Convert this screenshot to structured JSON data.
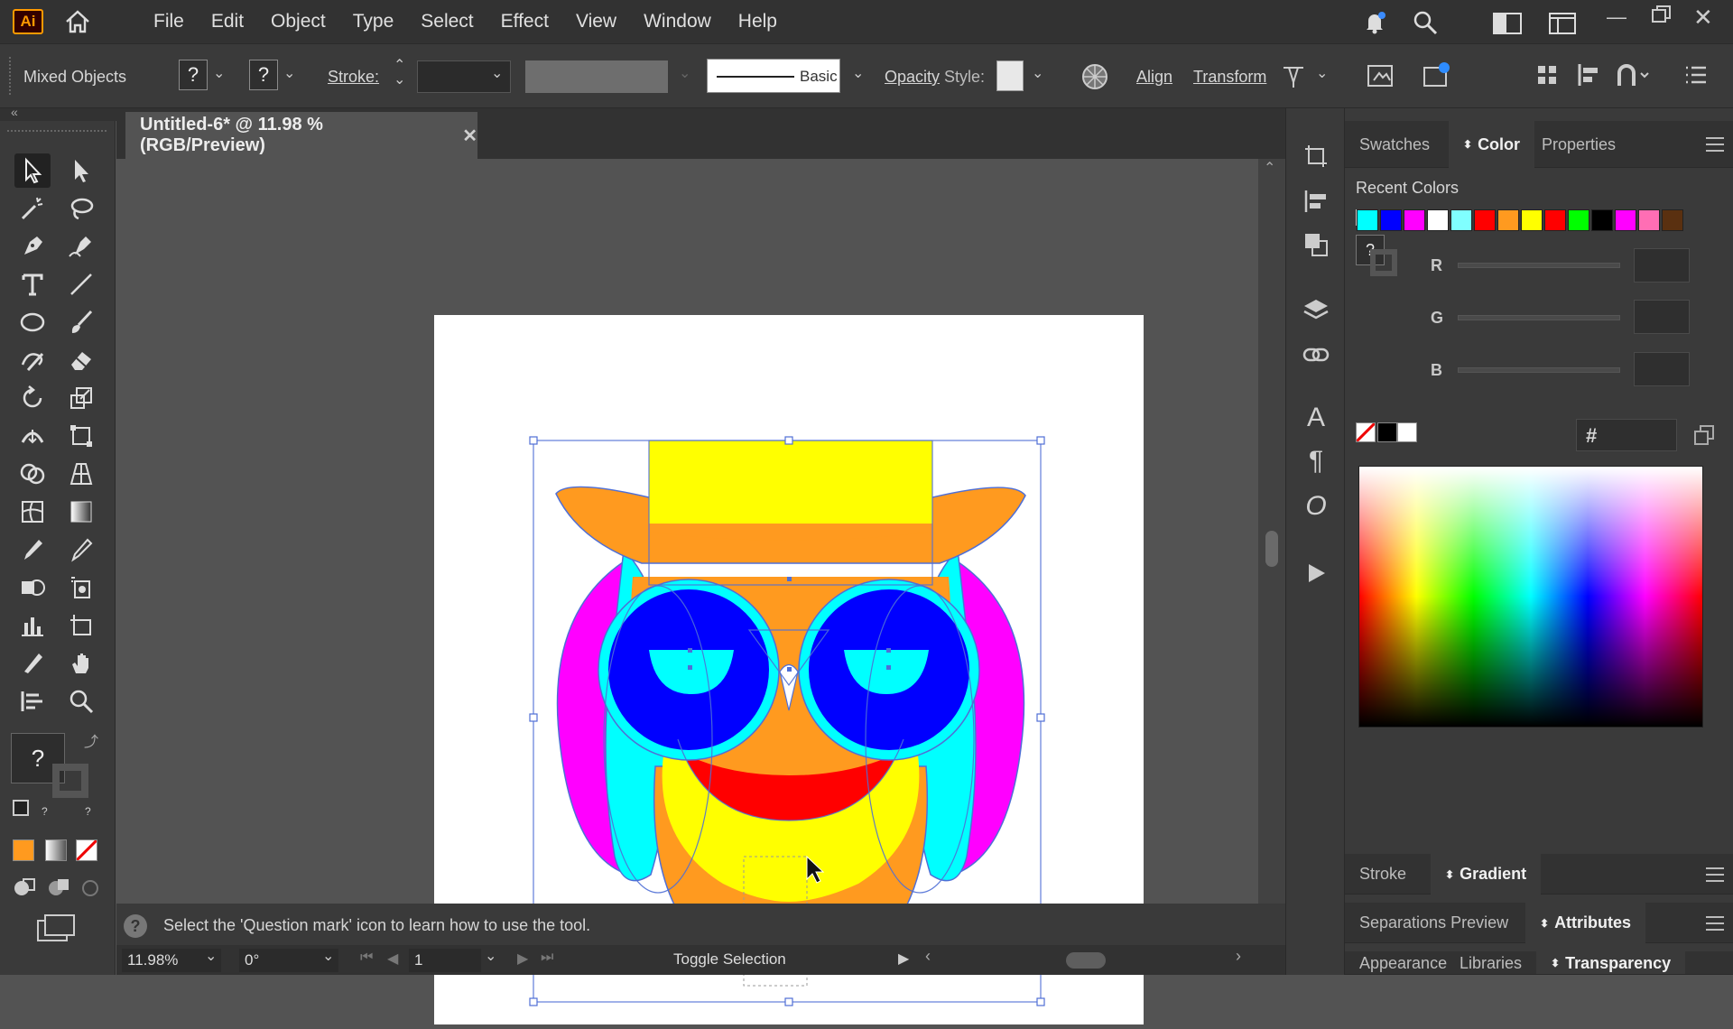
{
  "app": {
    "logo": "Ai",
    "title_tab": "Untitled-6* @ 11.98 % (RGB/Preview)"
  },
  "menu": [
    "File",
    "Edit",
    "Object",
    "Type",
    "Select",
    "Effect",
    "View",
    "Window",
    "Help"
  ],
  "control": {
    "selection_label": "Mixed Objects",
    "fill_glyph": "?",
    "stroke_glyph": "?",
    "stroke_label": "Stroke:",
    "brush_label": "Basic",
    "opacity_label": "Opacity",
    "style_label": "Style:",
    "align_label": "Align",
    "transform_label": "Transform"
  },
  "toolbar": {
    "fill_glyph": "?",
    "stroke_glyph": "?"
  },
  "status": {
    "hint": "Select the 'Question mark' icon to learn how to use the tool.",
    "help_glyph": "?"
  },
  "bottom": {
    "zoom": "11.98%",
    "rotation": "0°",
    "artboard_num": "1",
    "status_text": "Toggle Selection"
  },
  "panels": {
    "top_tabs": [
      "Swatches",
      "Color",
      "Properties"
    ],
    "active_top_tab": "Color",
    "recent_colors_label": "Recent Colors",
    "recent_colors": [
      "#00ffff",
      "#0000ff",
      "#ff00ff",
      "#ffffff",
      "#80ffff",
      "#ff0000",
      "#ff9a1f",
      "#ffff00",
      "#ff0000",
      "#00ff00",
      "#000000",
      "#ff00ff",
      "#ff6eb4",
      "#5a3010"
    ],
    "rgb_labels": [
      "R",
      "G",
      "B"
    ],
    "hex_symbol": "#",
    "color_question": "?",
    "stroke_tabs": [
      "Stroke",
      "Gradient"
    ],
    "sep_tabs": [
      "Separations Preview",
      "Attributes"
    ],
    "app_tabs": [
      "Appearance",
      "Libraries",
      "Transparency"
    ]
  },
  "colors": {
    "accent_orange": "#ff9a1f",
    "cyan": "#00ffff",
    "blue": "#0000ff",
    "magenta": "#ff00ff",
    "yellow": "#ffff00",
    "red": "#ff0000",
    "selection": "#4f6fd6"
  }
}
